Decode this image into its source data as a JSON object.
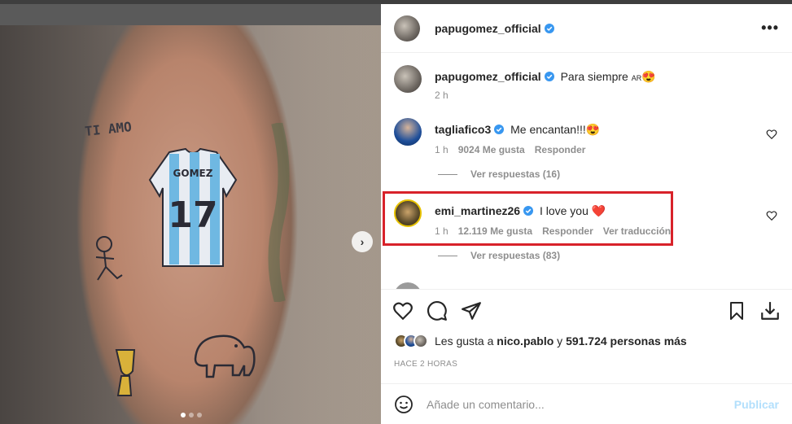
{
  "post": {
    "username": "papugomez_official",
    "more_label": "•••"
  },
  "caption": {
    "username": "papugomez_official",
    "text": "Para siempre",
    "flag": "AR",
    "emoji": "😍",
    "time": "2 h"
  },
  "comments": [
    {
      "username": "tagliafico3",
      "text": "Me encantan!!!",
      "emoji": "😍",
      "time": "1 h",
      "likes": "9024 Me gusta",
      "reply": "Responder",
      "view_replies": "Ver respuestas (16)"
    },
    {
      "username": "emi_martinez26",
      "text": "I love you",
      "emoji": "❤️",
      "time": "1 h",
      "likes": "12.119 Me gusta",
      "reply": "Responder",
      "translate": "Ver traducción",
      "view_replies": "Ver respuestas (83)"
    }
  ],
  "likes_summary": {
    "prefix": "Les gusta a",
    "user": "nico.pablo",
    "connector": "y",
    "count": "591.724 personas más"
  },
  "time_ago": "HACE 2 HORAS",
  "add_comment": {
    "placeholder": "Añade un comentario...",
    "post_label": "Publicar"
  },
  "photo": {
    "dots_total": 3,
    "dot_active": 1,
    "jersey_name": "GOMEZ",
    "jersey_number": "17",
    "tattoo_text": "TI AMO"
  },
  "colors": {
    "verified": "#3897f0",
    "highlight": "#d8222a",
    "post_button": "#b2dffc"
  }
}
